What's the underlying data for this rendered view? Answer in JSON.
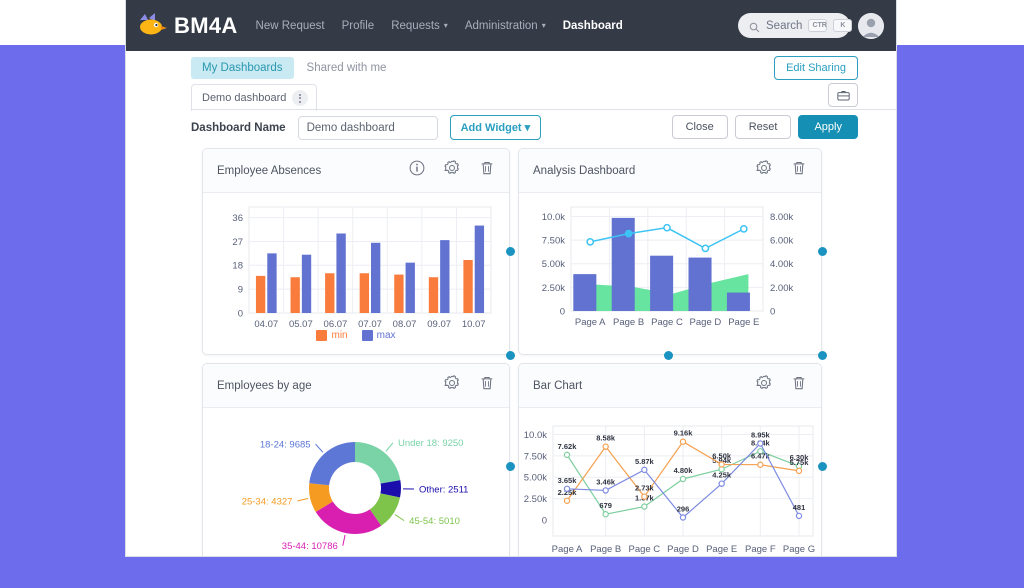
{
  "navbar": {
    "brand": "BM4A",
    "logo_icon": "bird-logo-icon",
    "links": [
      {
        "label": "New Request",
        "active": false,
        "caret": false
      },
      {
        "label": "Profile",
        "active": false,
        "caret": false
      },
      {
        "label": "Requests",
        "active": false,
        "caret": true
      },
      {
        "label": "Administration",
        "active": false,
        "caret": true
      },
      {
        "label": "Dashboard",
        "active": true,
        "caret": false
      }
    ],
    "search": {
      "placeholder": "Search",
      "kbd1": "CTR",
      "kbd2": "K",
      "icon": "search-icon"
    },
    "avatar_icon": "user-avatar-icon"
  },
  "toolbar": {
    "tabs": [
      {
        "label": "My Dashboards",
        "selected": true
      },
      {
        "label": "Shared with me",
        "selected": false
      }
    ],
    "edit_sharing_label": "Edit Sharing",
    "dashboard_tab_label": "Demo dashboard",
    "folder_icon": "folder-icon",
    "name_label": "Dashboard Name",
    "name_value": "Demo dashboard",
    "name_placeholder": "Dashboard Name",
    "add_widget_label": "Add Widget",
    "close_label": "Close",
    "reset_label": "Reset",
    "apply_label": "Apply"
  },
  "colors": {
    "accent_teal": "#1590b4",
    "navbar_bg": "#343a46",
    "backdrop": "#6c6ced",
    "handle": "#1b93c0",
    "orange": "#f97c3c",
    "blue": "#6172d1",
    "green": "#5fe39a",
    "cyan": "#3dc4f5"
  },
  "widgets": [
    {
      "title": "Employee Absences",
      "icons": [
        "info-icon",
        "gear-icon",
        "trash-icon"
      ]
    },
    {
      "title": "Analysis Dashboard",
      "icons": [
        "gear-icon",
        "trash-icon"
      ]
    },
    {
      "title": "Employees by age",
      "icons": [
        "gear-icon",
        "trash-icon"
      ]
    },
    {
      "title": "Bar Chart",
      "icons": [
        "gear-icon",
        "trash-icon"
      ]
    }
  ],
  "chart_data": [
    {
      "type": "bar",
      "title": "Employee Absences",
      "categories": [
        "04.07",
        "05.07",
        "06.07",
        "07.07",
        "08.07",
        "09.07",
        "10.07"
      ],
      "series": [
        {
          "name": "min",
          "color": "#f97c3c",
          "values": [
            14,
            13.5,
            15,
            15,
            14.5,
            13.5,
            20
          ]
        },
        {
          "name": "max",
          "color": "#6172d1",
          "values": [
            22.5,
            22,
            30,
            26.5,
            19,
            27.5,
            33
          ]
        }
      ],
      "ylim": [
        0,
        40
      ],
      "yticks": [
        0,
        9,
        18,
        27,
        36
      ],
      "ytick_labels": [
        "0",
        "9",
        "18",
        "27",
        "36"
      ],
      "xlabel": "",
      "ylabel": "",
      "grid": true,
      "legend": "bottom"
    },
    {
      "type": "bar",
      "title": "Analysis Dashboard",
      "categories": [
        "Page A",
        "Page B",
        "Page C",
        "Page D",
        "Page E"
      ],
      "series": [
        {
          "name": "bar-primary",
          "color": "#6172d1",
          "axis": "left",
          "values": [
            3900,
            9850,
            5850,
            5650,
            1950
          ]
        },
        {
          "name": "area-secondary",
          "color": "#5fe39a",
          "axis": "left",
          "values": [
            2800,
            2550,
            1800,
            2950,
            3900
          ]
        },
        {
          "name": "line-right",
          "color": "#3dc4f5",
          "axis": "right",
          "values": [
            5850,
            6550,
            7050,
            5300,
            6950
          ]
        }
      ],
      "ylim": [
        0,
        11000
      ],
      "yticks": [
        0,
        2500,
        5000,
        7500,
        10000
      ],
      "ytick_labels": [
        "0",
        "2.50k",
        "5.00k",
        "7.50k",
        "10.0k"
      ],
      "y2lim": [
        0,
        8800
      ],
      "y2ticks": [
        0,
        2000,
        4000,
        6000,
        8000
      ],
      "y2tick_labels": [
        "0",
        "2.00k",
        "4.00k",
        "6.00k",
        "8.00k"
      ],
      "grid": true,
      "legend": "none"
    },
    {
      "type": "pie",
      "title": "Employees by age",
      "donut": true,
      "slices": [
        {
          "label": "Under 18",
          "value": 9250,
          "color": "#79d3a7",
          "text": "Under 18: 9250"
        },
        {
          "label": "Other",
          "value": 2511,
          "color": "#1a0dab",
          "text": "Other: 2511"
        },
        {
          "label": "45-54",
          "value": 5010,
          "color": "#7ec44b",
          "text": "45-54: 5010"
        },
        {
          "label": "35-44",
          "value": 10786,
          "color": "#d81fb0",
          "text": "35-44: 10786"
        },
        {
          "label": "25-34",
          "value": 4327,
          "color": "#f59b22",
          "text": "25-34: 4327"
        },
        {
          "label": "18-24",
          "value": 9685,
          "color": "#5c77d6",
          "text": "18-24: 9685"
        }
      ],
      "legend": "labels-outside"
    },
    {
      "type": "line",
      "title": "Bar Chart",
      "categories": [
        "Page A",
        "Page B",
        "Page C",
        "Page D",
        "Page E",
        "Page F",
        "Page G"
      ],
      "ylim": [
        0,
        11000
      ],
      "yticks": [
        0,
        2500,
        5000,
        7500,
        10000
      ],
      "ytick_labels": [
        "0",
        "2.50k",
        "5.00k",
        "7.50k",
        "10.0k"
      ],
      "grid": true,
      "series": [
        {
          "name": "green",
          "color": "#7fcf9f",
          "values": [
            7620,
            679,
            1570,
            4800,
            5940,
            8040,
            6300
          ],
          "labels": [
            "7.62k",
            "679",
            "1.57k",
            "4.80k",
            "5.94k",
            "8.04k",
            "6.30k"
          ]
        },
        {
          "name": "orange",
          "color": "#f5a050",
          "values": [
            2250,
            8580,
            2730,
            9160,
            6500,
            6470,
            5750
          ],
          "labels": [
            "2.25k",
            "8.58k",
            "2.73k",
            "9.16k",
            "6.50k",
            "6.47k",
            "5.75k"
          ]
        },
        {
          "name": "blue",
          "color": "#7c8ae0",
          "values": [
            3650,
            3460,
            5870,
            296,
            4250,
            8950,
            481
          ],
          "labels": [
            "3.65k",
            "3.46k",
            "5.87k",
            "296",
            "4.25k",
            "8.95k",
            "481"
          ]
        }
      ]
    }
  ]
}
